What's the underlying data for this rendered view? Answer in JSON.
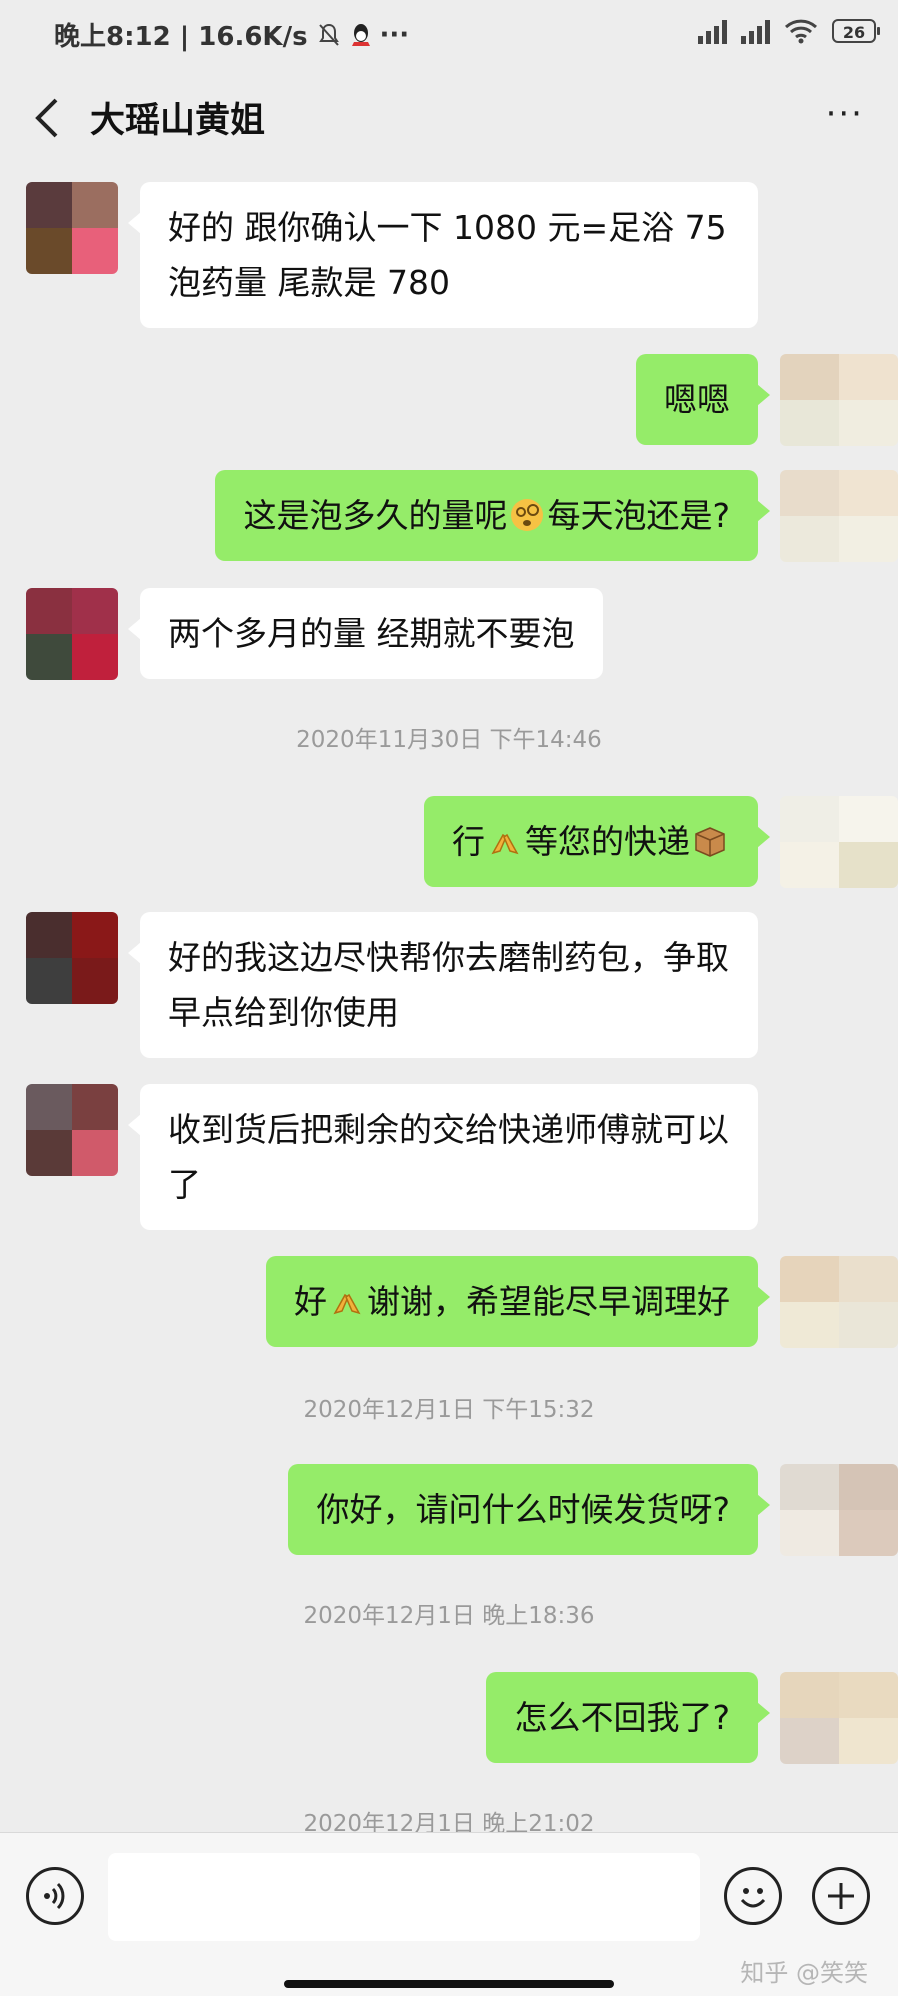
{
  "status_bar": {
    "time_speed": "晚上8:12 | 16.6K/s",
    "more": "···",
    "battery": "26"
  },
  "header": {
    "title": "大瑶山黄姐",
    "more": "···"
  },
  "messages": [
    {
      "side": "in",
      "text": "好的  跟你确认一下   1080 元=足浴 75 泡药量   尾款是 780"
    },
    {
      "side": "out",
      "text": "嗯嗯"
    },
    {
      "side": "out",
      "text_a": "这是泡多久的量呢",
      "emoji": "dizzy-face",
      "text_b": "每天泡还是?"
    },
    {
      "side": "in",
      "text": "两个多月的量  经期就不要泡"
    },
    {
      "side": "out",
      "text_a": "行",
      "emoji": "folded-hands",
      "text_b": "等您的快递",
      "emoji2": "package"
    },
    {
      "side": "in",
      "text": "好的我这边尽快帮你去磨制药包，争取早点给到你使用"
    },
    {
      "side": "in",
      "text": "收到货后把剩余的交给快递师傅就可以了"
    },
    {
      "side": "out",
      "text_a": "好",
      "emoji": "folded-hands",
      "text_b": "谢谢，希望能尽早调理好"
    },
    {
      "side": "out",
      "text": "你好，请问什么时候发货呀?"
    },
    {
      "side": "out",
      "text": "怎么不回我了?"
    }
  ],
  "timestamps": [
    "2020年11月30日 下午14:46",
    "2020年12月1日 下午15:32",
    "2020年12月1日 晚上18:36",
    "2020年12月1日 晚上21:02"
  ],
  "watermark": "知乎 @笑笑",
  "colors": {
    "background": "#ededed",
    "incoming_bubble": "#ffffff",
    "outgoing_bubble": "#95ec69"
  }
}
